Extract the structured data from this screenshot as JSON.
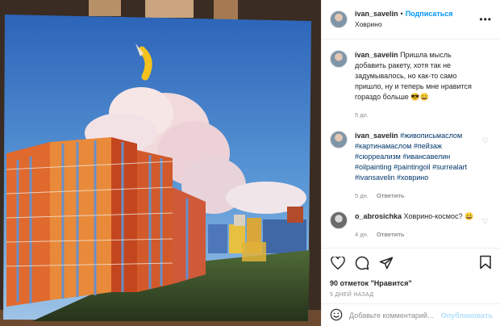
{
  "post": {
    "author": "ivan_savelin",
    "follow_label": "Подписаться",
    "location": "Ховрино",
    "caption": "Пришла мысль добавить ракету, хотя так не задумывалось, но как-то само пришло, ну и теперь мне нравится гораздо больше 😎😀",
    "caption_age": "5 дн."
  },
  "comments": [
    {
      "author": "ivan_savelin",
      "tags": "#живописьмаслом #картинамаслом #пейзаж #сюрреализм #ивансавелин #oilpainting #paintingoil #surrealart #ivansavelin #ховрино",
      "age": "5 дн.",
      "reply_label": "Ответить"
    },
    {
      "author": "o_abrosichka",
      "text": "Ховрино-космос? 😄",
      "age": "4 дн.",
      "reply_label": "Ответить"
    }
  ],
  "likes_text": "90 отметок \"Нравится\"",
  "posted_ago": "5 ДНЕЙ НАЗАД",
  "add_comment_placeholder": "Добавьте комментарий...",
  "publish_label": "Опубликовать",
  "colors": {
    "link": "#0095f6",
    "hashtag": "#00376b",
    "muted": "#8e8e8e"
  }
}
